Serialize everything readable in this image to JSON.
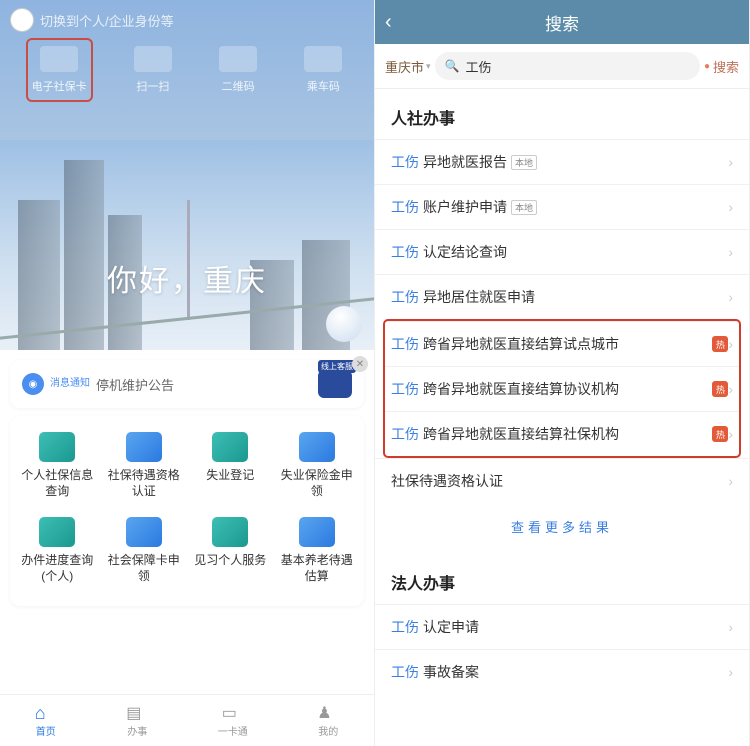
{
  "left": {
    "user_label": "切换到个人/企业身份等",
    "quick": [
      {
        "label": "电子社保卡",
        "highlight": true
      },
      {
        "label": "扫一扫"
      },
      {
        "label": "二维码"
      },
      {
        "label": "乘车码"
      }
    ],
    "greeting": "你好，重庆",
    "notice_tag": "消息通知",
    "notice_text": "停机维护公告",
    "kefu_label": "线上客服",
    "grid_row1": [
      {
        "label": "个人社保信息查询"
      },
      {
        "label": "社保待遇资格认证"
      },
      {
        "label": "失业登记"
      },
      {
        "label": "失业保险金申领"
      }
    ],
    "grid_row2": [
      {
        "label": "办件进度查询(个人)"
      },
      {
        "label": "社会保障卡申领"
      },
      {
        "label": "见习个人服务"
      },
      {
        "label": "基本养老待遇估算"
      }
    ],
    "tabs": [
      {
        "label": "首页"
      },
      {
        "label": "办事"
      },
      {
        "label": "一卡通"
      },
      {
        "label": "我的"
      }
    ]
  },
  "right": {
    "header": "搜索",
    "city": "重庆市",
    "search_icon": "🔍",
    "query": "工伤",
    "search_btn": "搜索",
    "section1": "人社办事",
    "items1": [
      {
        "kw": "工伤",
        "rest": "异地就医报告",
        "local": "本地"
      },
      {
        "kw": "工伤",
        "rest": "账户维护申请",
        "local": "本地"
      },
      {
        "kw": "工伤",
        "rest": "认定结论查询"
      },
      {
        "kw": "工伤",
        "rest": "异地居住就医申请"
      }
    ],
    "items_boxed": [
      {
        "kw": "工伤",
        "rest": "跨省异地就医直接结算试点城市",
        "hot": "热"
      },
      {
        "kw": "工伤",
        "rest": "跨省异地就医直接结算协议机构",
        "hot": "热"
      },
      {
        "kw": "工伤",
        "rest": "跨省异地就医直接结算社保机构",
        "hot": "热"
      }
    ],
    "items1b": [
      {
        "rest": "社保待遇资格认证"
      }
    ],
    "more": "查看更多结果",
    "section2": "法人办事",
    "items2": [
      {
        "kw": "工伤",
        "rest": "认定申请"
      },
      {
        "kw": "工伤",
        "rest": "事故备案"
      }
    ]
  }
}
